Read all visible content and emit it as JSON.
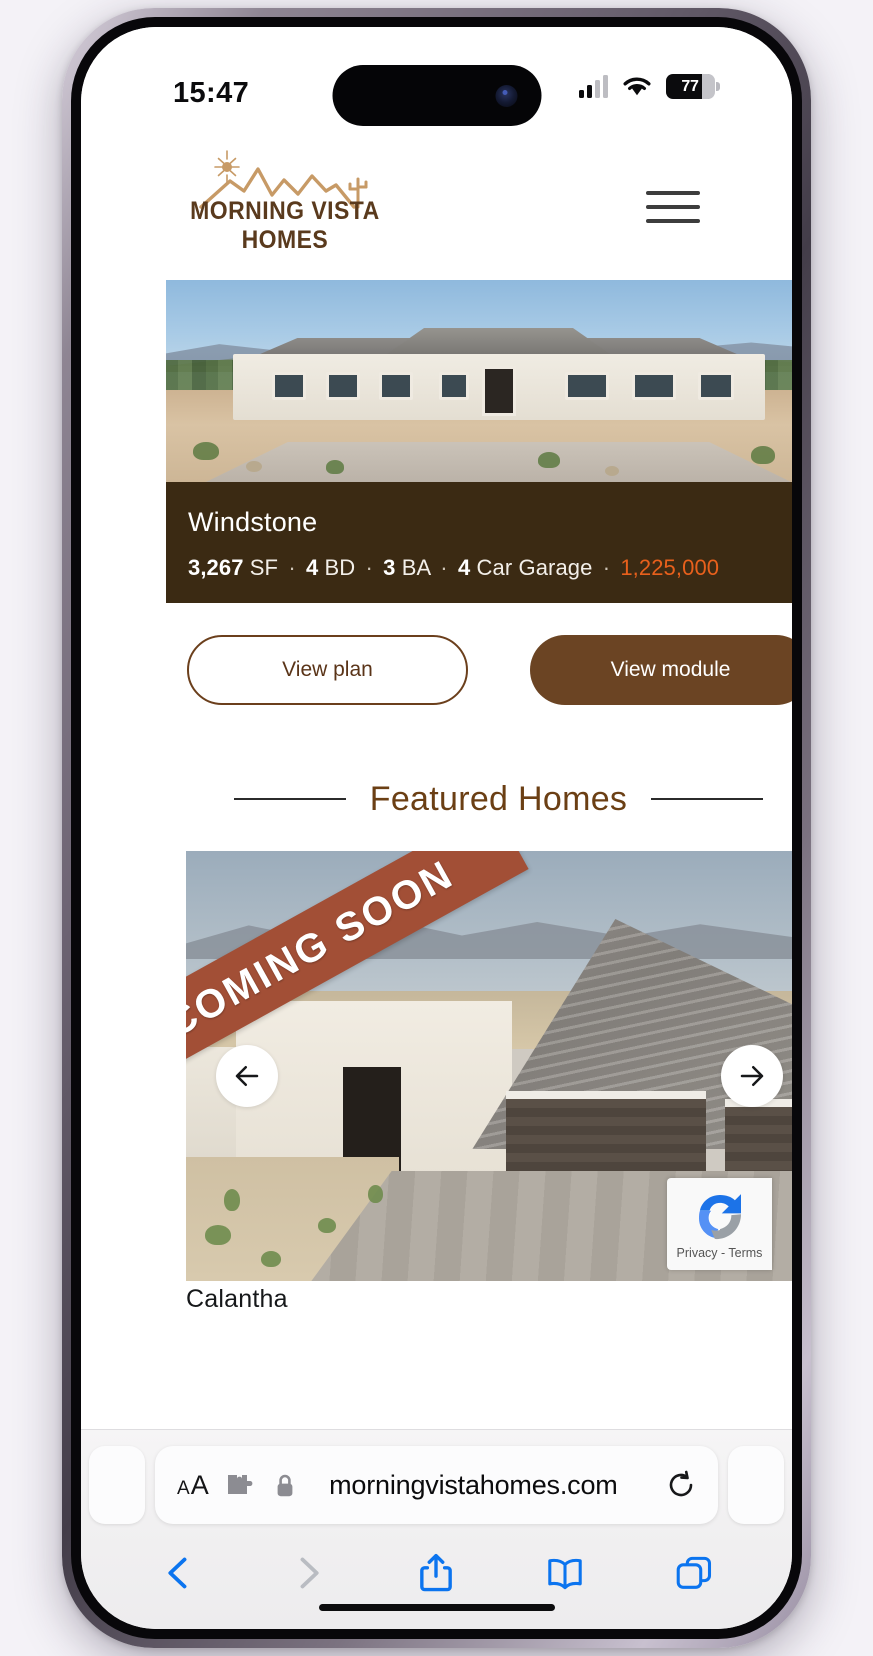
{
  "status_bar": {
    "time": "15:47",
    "battery_percent": "77",
    "signal_icon": "cellular-signal-icon",
    "wifi_icon": "wifi-icon",
    "battery_icon": "battery-icon"
  },
  "site_header": {
    "logo_text": "MORNING VISTA HOMES",
    "logo_mark": "sun-mountains-cactus-logo",
    "menu_icon": "hamburger-menu-icon"
  },
  "hero": {
    "image_alt": "desert-home-exterior"
  },
  "plan_detail": {
    "name": "Windstone",
    "sqft": "3,267",
    "sqft_unit": "SF",
    "beds": "4",
    "beds_unit": "BD",
    "baths": "3",
    "baths_unit": "BA",
    "garage": "4",
    "garage_unit": "Car Garage",
    "price": "1,225,000",
    "separator": "·",
    "bar_color": "#3b2a13",
    "price_color": "#e8601c"
  },
  "cta": {
    "view_plan_label": "View plan",
    "view_module_label": "View module",
    "outline_color": "#6b3f1c",
    "fill_color": "#6b4423"
  },
  "featured": {
    "heading": "Featured Homes",
    "heading_color": "#6b3f14",
    "ribbon_label": "COMING SOON",
    "ribbon_color": "#a24f36",
    "home_name": "Calantha",
    "prev_icon": "arrow-left-icon",
    "next_icon": "arrow-right-icon"
  },
  "recaptcha": {
    "links": "Privacy - Terms",
    "logo": "recaptcha-logo-icon"
  },
  "safari": {
    "text_size_small": "A",
    "text_size_large": "A",
    "extensions_icon": "puzzle-piece-icon",
    "lock_icon": "lock-icon",
    "url": "morningvistahomes.com",
    "reload_icon": "reload-icon",
    "back_icon": "chevron-left-icon",
    "forward_icon": "chevron-right-icon",
    "share_icon": "share-icon",
    "bookmarks_icon": "book-icon",
    "tabs_icon": "tabs-icon",
    "accent_color": "#0b74ef"
  }
}
